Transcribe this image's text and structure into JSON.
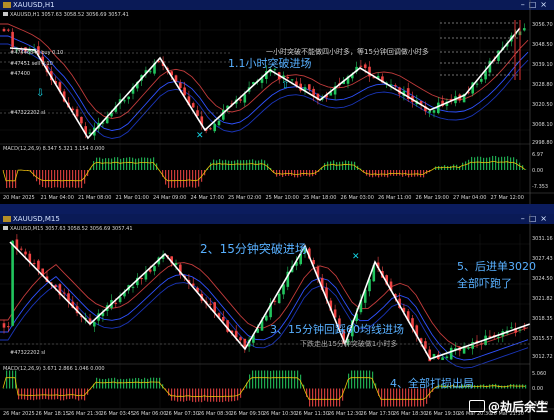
{
  "top_window": {
    "title": "XAUUSD,H1",
    "symbol_line": "XAUUSD,H1  3057.63 3058.52 3056.69 3057.41",
    "order_labels": [
      "#47446846 buy 0.10",
      "#47451 sell 0.10",
      "#47400",
      "#47322202 sl"
    ],
    "annotations": [
      {
        "text": "1.1小时突破进场",
        "color": "#58b0ff"
      },
      {
        "text": "一小时突破不能做四小时多，等15分钟回调做小时多",
        "color": "#cfcfcf"
      }
    ],
    "macd_label": "MACD(12,26,9) 8.347 5.321 3.154 0.000",
    "price_ticks": [
      "3056.70",
      "3048.50",
      "3039.10",
      "3028.80",
      "3020.50",
      "3008.10",
      "2998.80"
    ],
    "macd_ticks": [
      "6.97",
      "0.00",
      "-7.353"
    ],
    "time_ticks": [
      "20 Mar 2025",
      "21 Mar 04:00",
      "21 Mar 08:00",
      "21 Mar 01:00",
      "24 Mar 09:00",
      "24 Mar 17:00",
      "25 Mar 02:00",
      "25 Mar 10:00",
      "25 Mar 18:00",
      "26 Mar 03:00",
      "26 Mar 11:00",
      "26 Mar 19:00",
      "27 Mar 04:00",
      "27 Mar 12:00"
    ]
  },
  "bottom_window": {
    "title": "XAUUSD,M15",
    "symbol_line": "XAUUSD,M15  3057.63 3058.52 3056.69 3057.41",
    "order_labels": [
      "#47322202 sl"
    ],
    "annotations": [
      {
        "text": "2、15分钟突破进场",
        "color": "#58b0ff"
      },
      {
        "text": "3、15分钟回踩60均线进场",
        "color": "#58b0ff"
      },
      {
        "text": "下跌走出15分钟突破做1小时多",
        "color": "#aaaaaa"
      },
      {
        "text": "4、全部打损出局",
        "color": "#58b0ff"
      },
      {
        "text": "5、后进单3020",
        "color": "#58b0ff"
      },
      {
        "text": "全部吓跑了",
        "color": "#58b0ff"
      }
    ],
    "macd_label": "MACD(12,26,9) 3.671 2.866 1.046 0.000",
    "price_ticks": [
      "3031.16",
      "3027.43",
      "3024.50",
      "3021.82",
      "3018.35",
      "3015.57",
      "3012.72"
    ],
    "macd_ticks": [
      "5.060",
      "0.00",
      "-3.940"
    ],
    "time_ticks": [
      "26 Mar 2025",
      "26 Mar 18:15",
      "26 Mar 21:30",
      "26 Mar 03:45",
      "26 Mar 06:00",
      "26 Mar 07:30",
      "26 Mar 08:30",
      "26 Mar 09:30",
      "26 Mar 10:30",
      "26 Mar 11:30",
      "26 Mar 12:30",
      "26 Mar 17:30",
      "26 Mar 18:30",
      "26 Mar 19:30",
      "26 Mar 20:30",
      "26 Mar 21:30"
    ]
  },
  "watermark": "@劫后余生",
  "colors": {
    "up": "#22c55e",
    "down": "#ef4444",
    "zigzag": "#ffffff",
    "ma": "#2f52ff",
    "cyan": "#14d6e6"
  }
}
